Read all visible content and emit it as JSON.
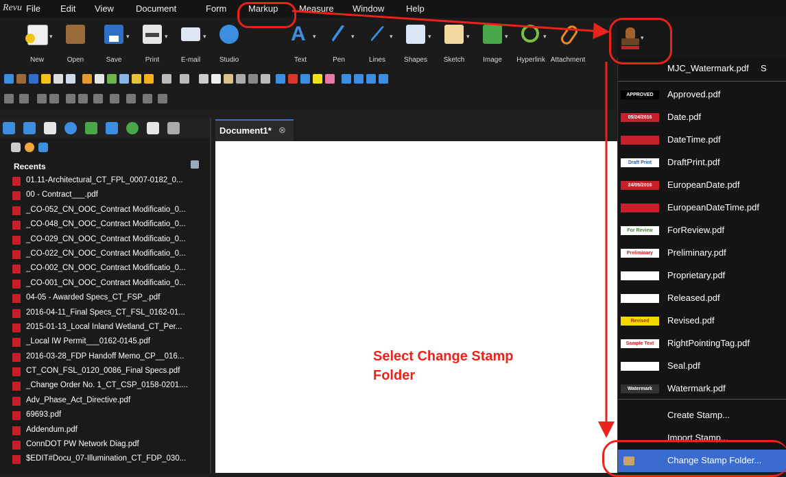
{
  "menubar": {
    "logo": "Revu",
    "items": [
      "File",
      "Edit",
      "View",
      "Document",
      "Form",
      "Markup",
      "Measure",
      "Window",
      "Help"
    ]
  },
  "toolbar": {
    "tools": [
      "New",
      "Open",
      "Save",
      "Print",
      "E-mail",
      "Studio",
      "Text",
      "Pen",
      "Lines",
      "Shapes",
      "Sketch",
      "Image",
      "Hyperlink",
      "Attachment"
    ]
  },
  "recents": {
    "title": "Recents",
    "files": [
      "01.11-Architectural_CT_FPL_0007-0182_0...",
      "00 - Contract___.pdf",
      "_CO-052_CN_OOC_Contract Modificatio_0...",
      "_CO-048_CN_OOC_Contract Modificatio_0...",
      "_CO-029_CN_OOC_Contract Modificatio_0...",
      "_CO-022_CN_OOC_Contract Modificatio_0...",
      "_CO-002_CN_OOC_Contract Modificatio_0...",
      "_CO-001_CN_OOC_Contract Modificatio_0...",
      "04-05 - Awarded Specs_CT_FSP_.pdf",
      "2016-04-11_Final Specs_CT_FSL_0162-01...",
      "2015-01-13_Local Inland Wetland_CT_Per...",
      "_Local IW Permit___0162-0145.pdf",
      "2016-03-28_FDP Handoff Memo_CP__016...",
      "CT_CON_FSL_0120_0086_Final Specs.pdf",
      "_Change Order No. 1_CT_CSP_0158-0201....",
      "Adv_Phase_Act_Directive.pdf",
      "69693.pdf",
      "Addendum.pdf",
      "ConnDOT PW Network Diag.pdf",
      "$EDIT#Docu_07-Illumination_CT_FDP_030..."
    ]
  },
  "document": {
    "tab_title": "Document1*",
    "close_glyph": "⊗"
  },
  "annotation": {
    "line1": "Select Change Stamp",
    "line2": "Folder"
  },
  "stamps": {
    "current": "MJC_Watermark.pdf",
    "current_suffix": "S",
    "items": [
      {
        "name": "Approved.pdf",
        "thumb": "APPROVED",
        "color": "#ffffff",
        "bg": "#000000"
      },
      {
        "name": "Date.pdf",
        "thumb": "05/24/2016",
        "color": "#ffffff",
        "bg": "#c8202a"
      },
      {
        "name": "DateTime.pdf",
        "thumb": "",
        "color": "#ffffff",
        "bg": "#c8202a"
      },
      {
        "name": "DraftPrint.pdf",
        "thumb": "Draft Print",
        "color": "#2f5aa8",
        "bg": "#ffffff"
      },
      {
        "name": "EuropeanDate.pdf",
        "thumb": "24/05/2016",
        "color": "#ffffff",
        "bg": "#c8202a"
      },
      {
        "name": "EuropeanDateTime.pdf",
        "thumb": "",
        "color": "#ffffff",
        "bg": "#c8202a"
      },
      {
        "name": "ForReview.pdf",
        "thumb": "For Review",
        "color": "#3a8a2a",
        "bg": "#ffffff"
      },
      {
        "name": "Preliminary.pdf",
        "thumb": "Preliminary",
        "color": "#c8202a",
        "bg": "#ffffff"
      },
      {
        "name": "Proprietary.pdf",
        "thumb": "",
        "color": "#c8202a",
        "bg": "#ffffff"
      },
      {
        "name": "Released.pdf",
        "thumb": "",
        "color": "#c8202a",
        "bg": "#ffffff"
      },
      {
        "name": "Revised.pdf",
        "thumb": "Revised",
        "color": "#c8202a",
        "bg": "#f5d800"
      },
      {
        "name": "RightPointingTag.pdf",
        "thumb": "Sample Text",
        "color": "#c8202a",
        "bg": "#ffffff"
      },
      {
        "name": "Seal.pdf",
        "thumb": "",
        "color": "#000000",
        "bg": "#ffffff"
      },
      {
        "name": "Watermark.pdf",
        "thumb": "Watermark",
        "color": "#ffffff",
        "bg": "#333333"
      }
    ],
    "actions": {
      "create": "Create Stamp...",
      "import": "Import Stamp...",
      "change_folder": "Change Stamp Folder..."
    }
  }
}
